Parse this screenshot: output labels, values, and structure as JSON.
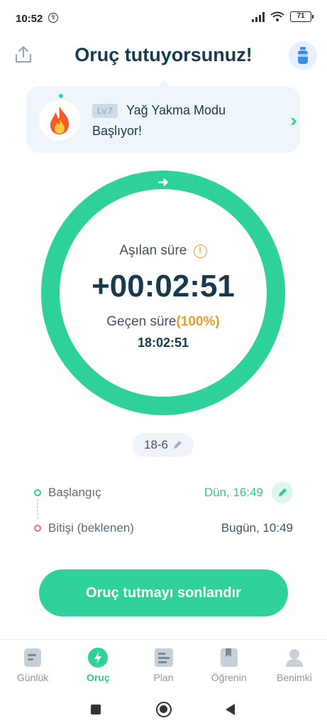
{
  "status_bar": {
    "time": "10:52",
    "battery": "71"
  },
  "header": {
    "title": "Oruç tutuyorsunuz!"
  },
  "banner": {
    "level": "Lv.7",
    "line1": "Yağ Yakma Modu",
    "line2": "Başlıyor!"
  },
  "ring": {
    "progress": 1.0,
    "elapsed_label": "Aşılan süre",
    "timer": "+00:02:51",
    "passed_label": "Geçen süre",
    "passed_percent": "(100%)",
    "passed_time": "18:02:51"
  },
  "plan": {
    "label": "18-6"
  },
  "times": {
    "start_label": "Başlangıç",
    "start_value": "Dün, 16:49",
    "end_label": "Bitişi (beklenen)",
    "end_value": "Bugün, 10:49"
  },
  "end_button": {
    "label": "Oruç tutmayı sonlandır"
  },
  "nav": {
    "items": [
      {
        "label": "Günlük",
        "icon": "journal-icon"
      },
      {
        "label": "Oruç",
        "icon": "lightning-icon"
      },
      {
        "label": "Plan",
        "icon": "plan-icon"
      },
      {
        "label": "Öğrenin",
        "icon": "bookmark-book-icon"
      },
      {
        "label": "Benimki",
        "icon": "person-icon"
      }
    ]
  },
  "colors": {
    "accent": "#2fd19a",
    "warning": "#f29b2a",
    "title": "#173a4f"
  }
}
